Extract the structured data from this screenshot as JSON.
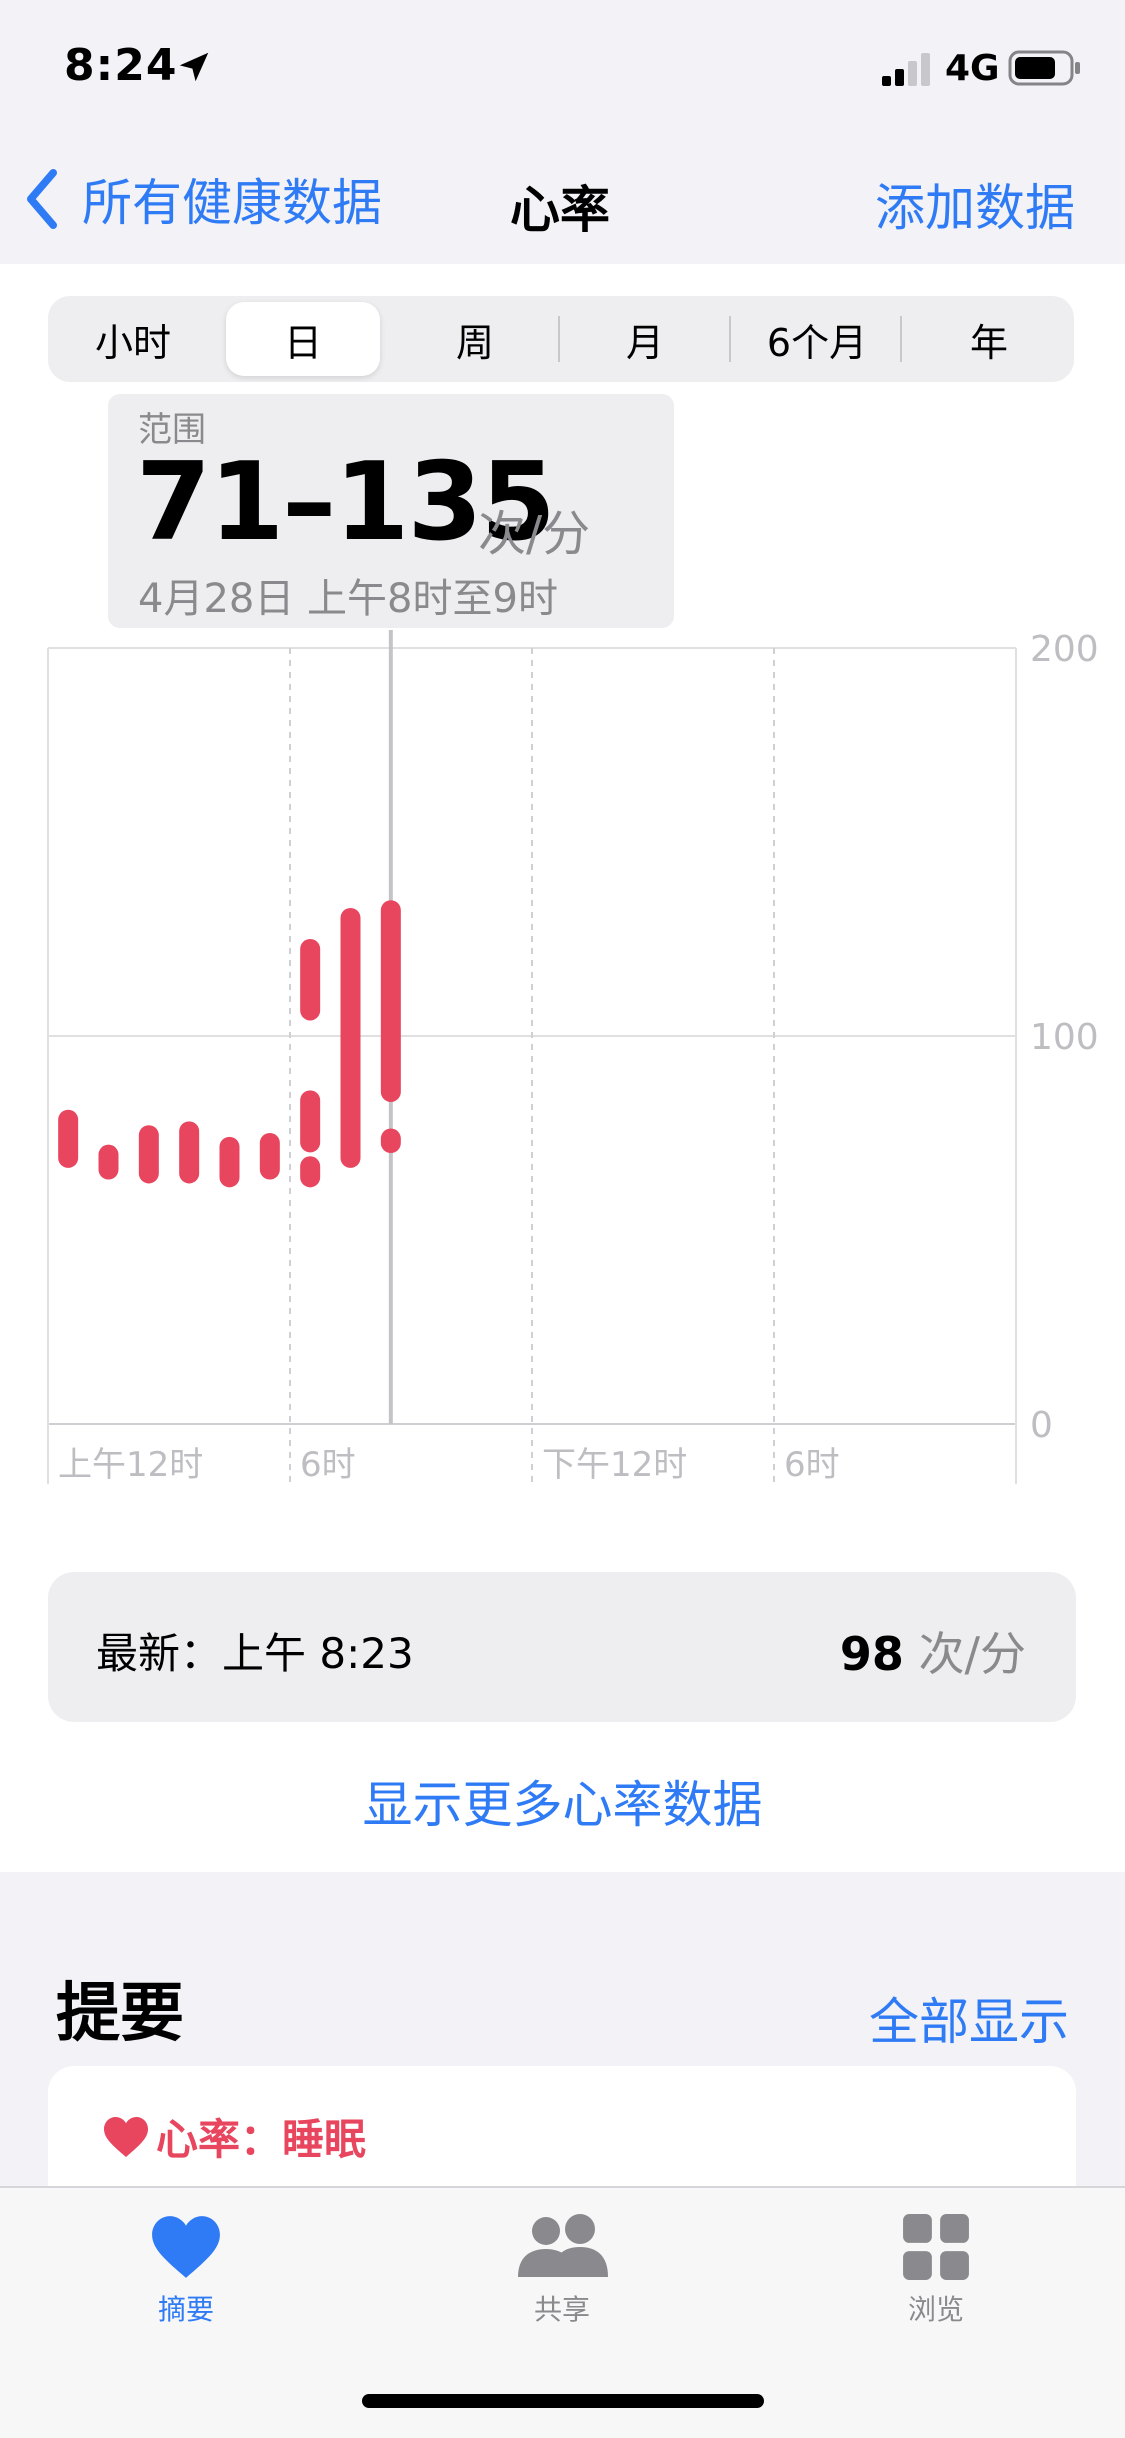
{
  "status_bar": {
    "time": "8:24",
    "network": "4G"
  },
  "nav": {
    "back_label": "所有健康数据",
    "title": "心率",
    "add_label": "添加数据"
  },
  "segments": {
    "items": [
      "小时",
      "日",
      "周",
      "月",
      "6个月",
      "年"
    ],
    "selected": "日"
  },
  "range": {
    "label": "范围",
    "value": "71–135",
    "unit": "次/分",
    "time": "4月28日 上午8时至9时"
  },
  "chart_data": {
    "type": "bar",
    "subtype": "range-bars",
    "x_tick_labels": [
      "上午12时",
      "6时",
      "下午12时",
      "6时"
    ],
    "y_tick_labels": [
      "200",
      "100",
      "0"
    ],
    "ylim": [
      0,
      200
    ],
    "x_unit": "hour of day",
    "xlim": [
      0,
      24
    ],
    "grid": true,
    "selected_hour": 8,
    "ranges": [
      {
        "x": 0.5,
        "low": 66,
        "high": 81
      },
      {
        "x": 1.5,
        "low": 63,
        "high": 72
      },
      {
        "x": 2.5,
        "low": 62,
        "high": 77
      },
      {
        "x": 3.5,
        "low": 62,
        "high": 78
      },
      {
        "x": 4.5,
        "low": 61,
        "high": 74
      },
      {
        "x": 5.5,
        "low": 63,
        "high": 75
      },
      {
        "x": 6.5,
        "low": 61,
        "high": 69
      },
      {
        "x": 6.5,
        "low": 70,
        "high": 86
      },
      {
        "x": 6.5,
        "low": 104,
        "high": 125
      },
      {
        "x": 7.5,
        "low": 66,
        "high": 133
      },
      {
        "x": 8.5,
        "low": 71,
        "high": 75
      },
      {
        "x": 8.5,
        "low": 83,
        "high": 135
      }
    ],
    "colors": {
      "bar": "#e8455e",
      "grid": "#e0e0e0",
      "selection": "#c4c4c8"
    }
  },
  "latest": {
    "label": "最新：上午 8:23",
    "value": "98",
    "unit": "次/分"
  },
  "show_more": "显示更多心率数据",
  "summary": {
    "title": "提要",
    "show_all": "全部显示",
    "card_title": "心率：睡眠"
  },
  "tabbar": {
    "items": [
      {
        "label": "摘要",
        "icon": "heart-icon",
        "active": true
      },
      {
        "label": "共享",
        "icon": "people-icon",
        "active": false
      },
      {
        "label": "浏览",
        "icon": "grid-icon",
        "active": false
      }
    ],
    "active_color": "#2f7bf5",
    "inactive_color": "#8a8a8e"
  }
}
